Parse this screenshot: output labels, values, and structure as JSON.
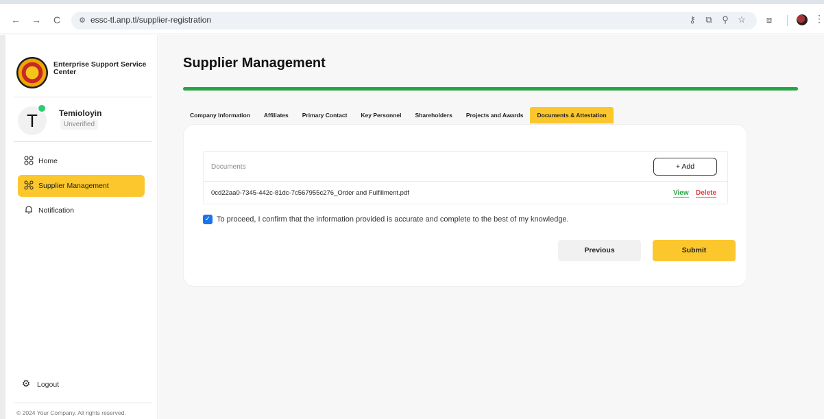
{
  "browser": {
    "url": "essc-tl.anp.tl/supplier-registration",
    "back_icon": "←",
    "forward_icon": "→",
    "reload_icon": "C"
  },
  "sidebar": {
    "brand": "Enterprise Support Service Center",
    "user": {
      "initial": "T",
      "name": "Temioloyin",
      "status": "Unverified"
    },
    "items": [
      {
        "label": "Home",
        "icon": "grid-icon"
      },
      {
        "label": "Supplier Management",
        "icon": "network-icon",
        "active": true
      },
      {
        "label": "Notification",
        "icon": "bell-icon"
      }
    ],
    "logout": "Logout",
    "copyright": "© 2024 Your Company. All rights reserved."
  },
  "main": {
    "title": "Supplier Management",
    "progress": 1.0,
    "tabs": [
      {
        "label": "Company Information"
      },
      {
        "label": "Affiliates"
      },
      {
        "label": "Primary Contact"
      },
      {
        "label": "Key Personnel"
      },
      {
        "label": "Shareholders"
      },
      {
        "label": "Projects and Awards"
      },
      {
        "label": "Documents & Attestation",
        "active": true
      }
    ],
    "documents": {
      "header": "Documents",
      "add_label": "+ Add",
      "rows": [
        {
          "name": "0cd22aa0-7345-442c-81dc-7c567955c276_Order and Fulfillment.pdf",
          "view": "View",
          "delete": "Delete"
        }
      ]
    },
    "confirm_text": "To proceed, I confirm that the information provided is accurate and complete to the best of my knowledge.",
    "confirm_checked": true,
    "previous_label": "Previous",
    "submit_label": "Submit"
  },
  "colors": {
    "accent": "#fcc62d",
    "progress": "#27a443",
    "view": "#27a443",
    "delete": "#e23c3c",
    "checkbox": "#1a73e8"
  }
}
